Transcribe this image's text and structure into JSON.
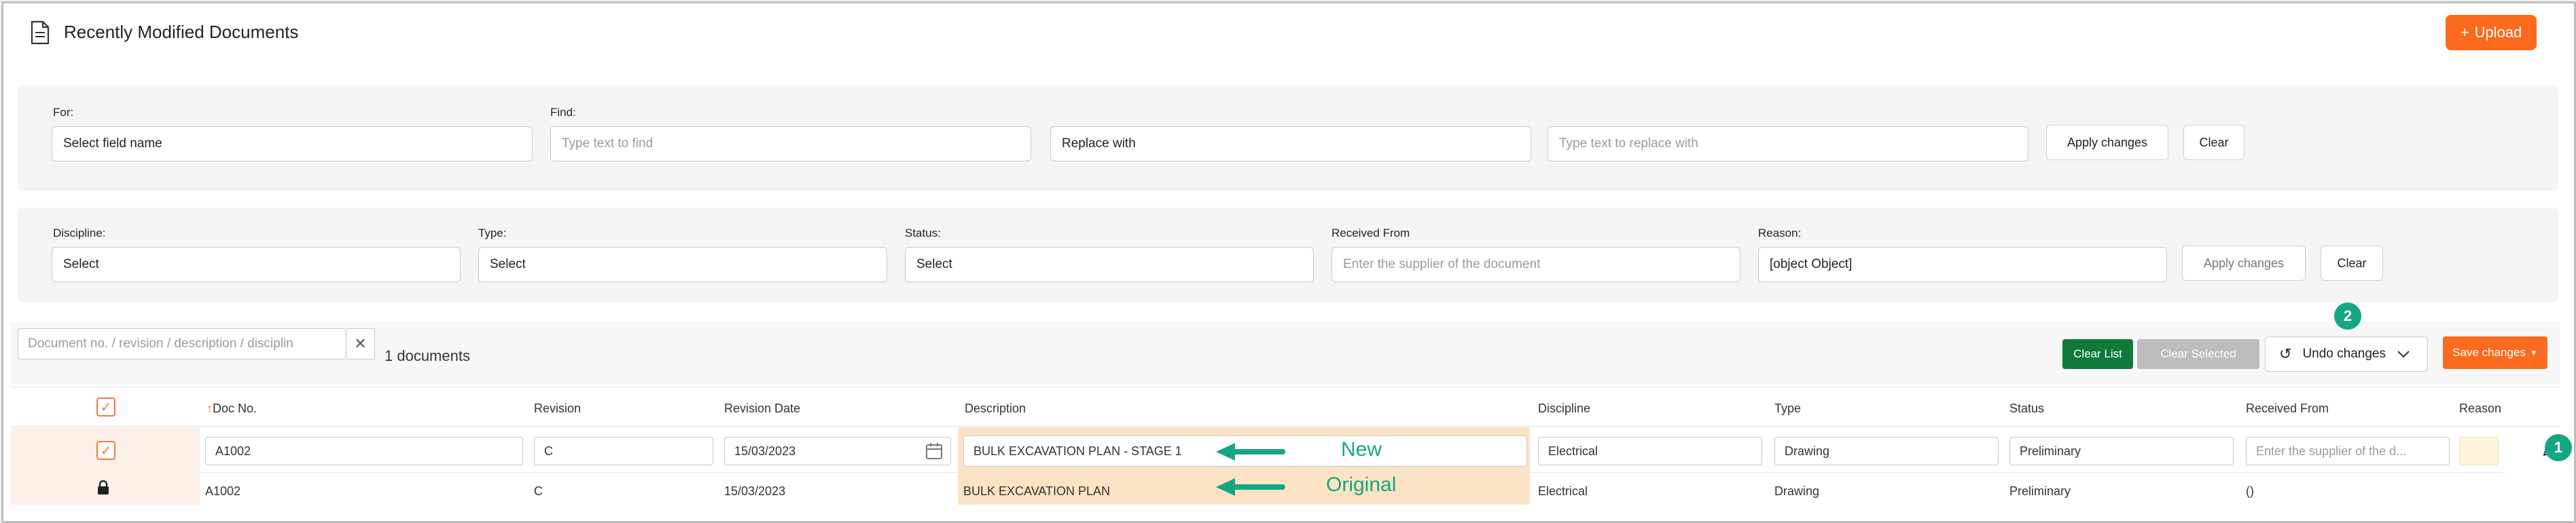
{
  "page": {
    "title": "Recently Modified Documents",
    "upload_label": "Upload"
  },
  "find_replace": {
    "for_label": "For:",
    "for_value": "Select field name",
    "find_label": "Find:",
    "find_placeholder": "Type text to find",
    "replace_value": "Replace with",
    "replace_placeholder": "Type text to replace with",
    "apply_label": "Apply changes",
    "clear_label": "Clear"
  },
  "filters": {
    "discipline_label": "Discipline:",
    "discipline_value": "Select",
    "type_label": "Type:",
    "type_value": "Select",
    "status_label": "Status:",
    "status_value": "Select",
    "received_label": "Received From",
    "received_placeholder": "Enter the supplier of the document",
    "reason_label": "Reason:",
    "reason_value": "[object Object]",
    "apply_label": "Apply changes",
    "clear_label": "Clear"
  },
  "toolbar": {
    "search_placeholder": "Document no. / revision / description / disciplin",
    "count": "1 documents",
    "clear_list": "Clear List",
    "clear_selected": "Clear Selected",
    "undo": "Undo changes",
    "save": "Save changes"
  },
  "table": {
    "columns": [
      "Doc No.",
      "Revision",
      "Revision Date",
      "Description",
      "Discipline",
      "Type",
      "Status",
      "Received From",
      "Reason"
    ],
    "edit_row": {
      "doc_no": "A1002",
      "revision": "C",
      "revision_date": "15/03/2023",
      "description": "BULK EXCAVATION PLAN - STAGE 1",
      "discipline": "Electrical",
      "type": "Drawing",
      "status": "Preliminary",
      "received_placeholder": "Enter the supplier of the d..."
    },
    "original_row": {
      "doc_no": "A1002",
      "revision": "C",
      "revision_date": "15/03/2023",
      "description": "BULK EXCAVATION PLAN",
      "discipline": "Electrical",
      "type": "Drawing",
      "status": "Preliminary",
      "received_from": "()"
    }
  },
  "annotations": {
    "new": "New",
    "original": "Original",
    "badge1": "1",
    "badge2": "2"
  },
  "colors": {
    "accent": "#fc6a1d",
    "annotation": "#17a583",
    "highlight": "#fde3c6",
    "green": "#0f7a3a"
  }
}
